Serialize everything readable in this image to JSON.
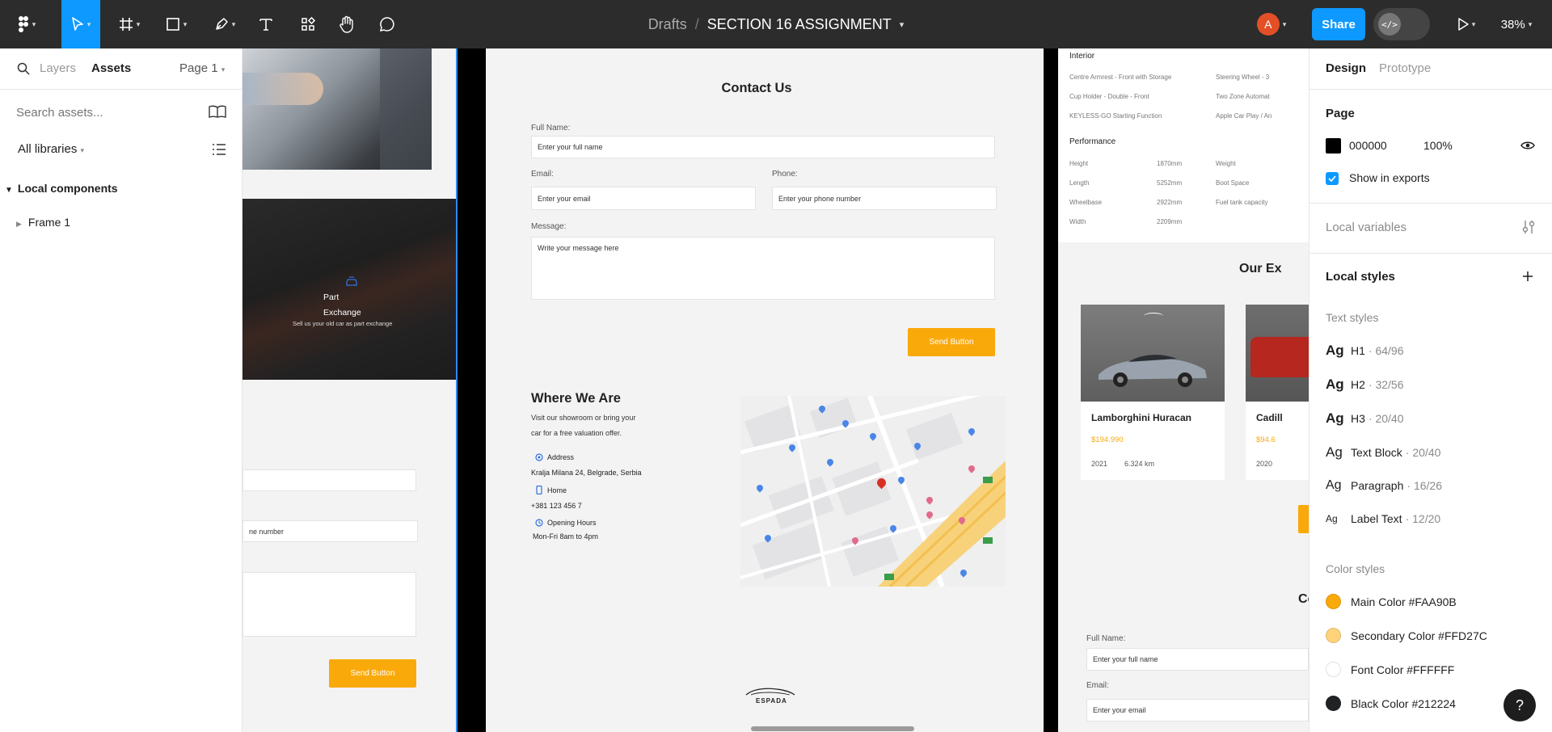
{
  "toolbar": {
    "breadcrumb_drafts": "Drafts",
    "breadcrumb_sep": "/",
    "file_name": "SECTION 16 ASSIGNMENT",
    "avatar_initial": "A",
    "share_label": "Share",
    "zoom": "38%",
    "icons": [
      "figma-menu-icon",
      "move-tool-icon",
      "frame-tool-icon",
      "shape-tool-icon",
      "pen-tool-icon",
      "text-tool-icon",
      "resources-icon",
      "hand-tool-icon",
      "comment-icon",
      "dev-mode-icon",
      "present-icon"
    ]
  },
  "left": {
    "tab_layers": "Layers",
    "tab_assets": "Assets",
    "page_selector": "Page 1",
    "search_placeholder": "Search assets...",
    "libraries": "All libraries",
    "local_components": "Local components",
    "tree": [
      {
        "label": "Frame 1"
      }
    ]
  },
  "right": {
    "tab_design": "Design",
    "tab_prototype": "Prototype",
    "page_heading": "Page",
    "page_color": "000000",
    "page_opacity": "100%",
    "show_in_exports": "Show in exports",
    "local_variables": "Local variables",
    "local_styles": "Local styles",
    "text_styles_heading": "Text styles",
    "text_styles": [
      {
        "ag": "Ag",
        "name": "H1",
        "meta": "· 64/96"
      },
      {
        "ag": "Ag",
        "name": "H2",
        "meta": "· 32/56"
      },
      {
        "ag": "Ag",
        "name": "H3",
        "meta": "· 20/40"
      },
      {
        "ag": "Ag",
        "name": "Text Block",
        "meta": "· 20/40"
      },
      {
        "ag": "Ag",
        "name": "Paragraph",
        "meta": "· 16/26"
      },
      {
        "ag": "Ag",
        "name": "Label Text",
        "meta": "· 12/20"
      }
    ],
    "color_styles_heading": "Color styles",
    "color_styles": [
      {
        "name": "Main Color #FAA90B",
        "color": "#FAA90B"
      },
      {
        "name": "Secondary Color #FFD27C",
        "color": "#FFD27C"
      },
      {
        "name": "Font Color #FFFFFF",
        "color": "#FFFFFF"
      },
      {
        "name": "Black Color #212224",
        "color": "#212224"
      }
    ],
    "help": "?"
  },
  "canvas": {
    "left_frame": {
      "part_title_1": "Part",
      "part_title_2": "Exchange",
      "part_desc": "Sell us your old car as part exchange",
      "phone_fragment": "ne number",
      "send_button": "Send Button"
    },
    "center_frame": {
      "contact_title": "Contact Us",
      "full_name_label": "Full Name:",
      "full_name_placeholder": "Enter your full name",
      "email_label": "Email:",
      "email_placeholder": "Enter your email",
      "phone_label": "Phone:",
      "phone_placeholder": "Enter your phone number",
      "message_label": "Message:",
      "message_placeholder": "Write your message here",
      "send_button": "Send Button",
      "where_title": "Where We Are",
      "where_desc_1": "Visit our showroom or bring your",
      "where_desc_2": "car for a free valuation offer.",
      "address_label": "Address",
      "address_value": "Kralja Milana 24, Belgrade, Serbia",
      "home_label": "Home",
      "home_value": "+381 123 456 7",
      "hours_label": "Opening Hours",
      "hours_value": "Mon-Fri 8am to 4pm",
      "logo_text": "ESPADA"
    },
    "right_frame": {
      "interior_title": "Interior",
      "interior_items": [
        "Centre Armrest - Front with Storage",
        "Cup Holder - Double - Front",
        "KEYLESS-GO Starting Function"
      ],
      "interior_items_2": [
        "Steering Wheel - 3",
        "Two Zone Automat",
        "Apple Car Play / An"
      ],
      "performance_title": "Performance",
      "perf_labels": [
        "Height",
        "Length",
        "Wheelbase",
        "Width"
      ],
      "perf_values": [
        "1870mm",
        "5252mm",
        "2922mm",
        "2209mm"
      ],
      "perf_labels_2": [
        "Weight",
        "Boot Space",
        "Fuel tank capacity"
      ],
      "section_title": "Our Ex",
      "car1_name": "Lamborghini Huracan",
      "car1_price": "$194.990",
      "car1_year": "2021",
      "car1_km": "6.324 km",
      "car2_name": "Cadill",
      "car2_price": "$94.6",
      "car2_year": "2020",
      "contact_fragment": "Co",
      "full_name_label": "Full Name:",
      "full_name_placeholder": "Enter your full name",
      "email_label": "Email:",
      "email_placeholder": "Enter your email"
    }
  }
}
